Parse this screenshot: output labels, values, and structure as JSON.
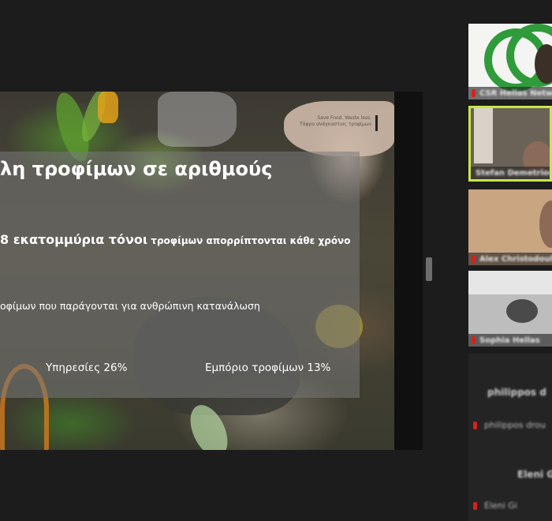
{
  "slide": {
    "title": "λη τροφίμων σε αριθμούς",
    "stat_highlight": "8 εκατομμύρια τόνοι",
    "stat_rest": " τροφίμων απορρίπτονται κάθε χρόνο",
    "line2": "οφίμων που παράγονται για ανθρώπινη κατανάλωση",
    "services": "Υπηρεσίες 26%",
    "food_trade": "Εμπόριο τροφίμων 13%",
    "watermark_line1": "Save Food. Waste less.",
    "watermark_line2": "Τάφρο ανάγκαστιος τροφίμων"
  },
  "participants": [
    {
      "name": "CSR Hellas Network"
    },
    {
      "name": "Stefan Demetriou"
    },
    {
      "name": "Alex Christodoulou"
    },
    {
      "name": "Sophia Hellas"
    }
  ],
  "participant_list": [
    {
      "name": "philippos d",
      "sub": "philippos drou"
    },
    {
      "name": "Eleni Gi",
      "sub": "Eleni Gi"
    }
  ],
  "colors": {
    "active_speaker_border": "#c8e64a",
    "mic_muted": "#d92020",
    "logo_green": "#2f9b3a"
  }
}
